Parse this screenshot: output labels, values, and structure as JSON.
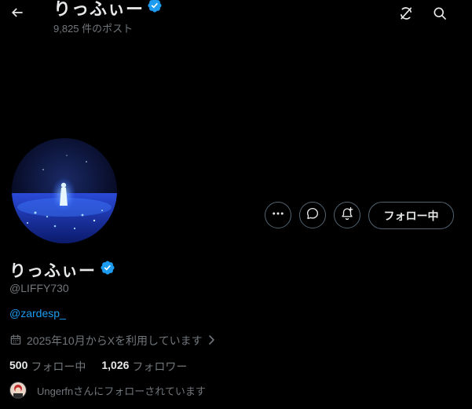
{
  "header": {
    "title": "りっふぃー",
    "post_count": "9,825 件のポスト"
  },
  "profile": {
    "display_name": "りっふぃー",
    "handle": "@LIFFY730",
    "bio_link": "@zardesp_",
    "joined": "2025年10月からXを利用しています",
    "following_count": "500",
    "following_label": "フォロー中",
    "followers_count": "1,026",
    "followers_label": "フォロワー",
    "followed_by": "Ungerfnさんにフォローされています"
  },
  "actions": {
    "follow_label": "フォロー中"
  },
  "colors": {
    "background": "#000000",
    "text": "#e7e9ea",
    "secondary_text": "#71767b",
    "link": "#1d9bf0",
    "verified": "#1d9bf0",
    "border": "#536471"
  },
  "icons": {
    "back": "arrow-left-icon",
    "grok": "grok-icon",
    "search": "search-icon",
    "more": "more-horizontal-icon",
    "message": "message-bubble-icon",
    "notify": "bell-plus-icon",
    "calendar": "calendar-icon",
    "chevron": "chevron-right-icon",
    "verified": "verified-badge-icon"
  }
}
